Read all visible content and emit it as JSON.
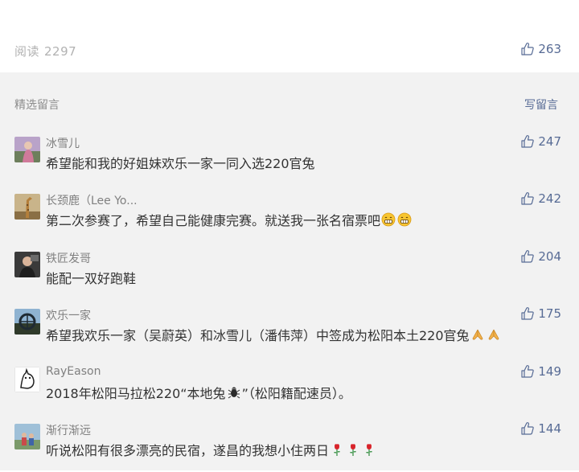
{
  "article": {
    "read_label": "阅读",
    "read_count": "2297",
    "like_count": "263"
  },
  "comments_section": {
    "title": "精选留言",
    "write_label": "写留言"
  },
  "comments": [
    {
      "nickname": "冰雪儿",
      "text": "希望能和我的好姐妹欢乐一家一同入选220官兔",
      "emoji": [],
      "likes": "247"
    },
    {
      "nickname": "长颈鹿（Lee Yo...",
      "text": "第二次参赛了，希望自己能健康完赛。就送我一张名宿票吧",
      "emoji": [
        "grin-emoji",
        "grin-emoji"
      ],
      "likes": "242"
    },
    {
      "nickname": "铁匠发哥",
      "text": "能配一双好跑鞋",
      "emoji": [],
      "likes": "204"
    },
    {
      "nickname": "欢乐一家",
      "text": "希望我欢乐一家（吴蔚英）和冰雪儿（潘伟萍）中签成为松阳本土220官兔",
      "emoji": [
        "pray-emoji",
        "pray-emoji"
      ],
      "likes": "175"
    },
    {
      "nickname": "RayEason",
      "text": "2018年松阳马拉松220“本地兔",
      "text2": "”（松阳籍配速员）。",
      "emoji": [
        "bug-emoji"
      ],
      "likes": "149"
    },
    {
      "nickname": "渐行渐远",
      "text": "听说松阳有很多漂亮的民宿，遂昌的我想小住两日",
      "emoji": [
        "rose-emoji",
        "rose-emoji",
        "rose-emoji"
      ],
      "likes": "144"
    }
  ],
  "colors": {
    "link": "#576b95",
    "muted": "#b2b2b2",
    "text": "#333333",
    "section_bg": "#f2f2f2"
  }
}
